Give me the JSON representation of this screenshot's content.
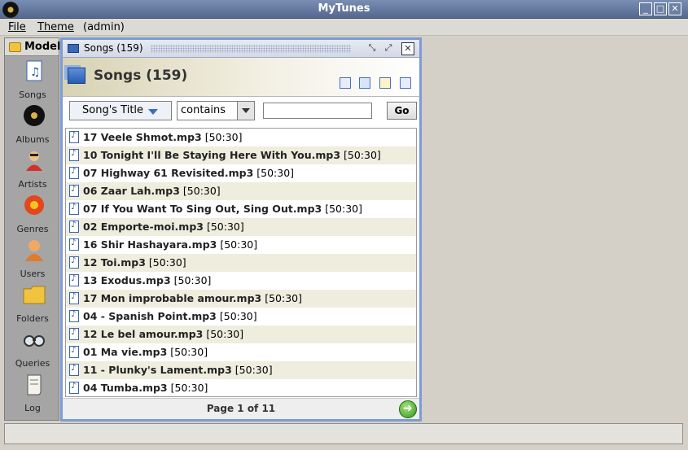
{
  "window": {
    "title": "MyTunes"
  },
  "menu": {
    "file": "File",
    "theme": "Theme",
    "user": "(admin)"
  },
  "sidebar": {
    "header": "Model",
    "items": [
      {
        "label": "Songs",
        "icon": "music-file-icon"
      },
      {
        "label": "Albums",
        "icon": "vinyl-record-icon"
      },
      {
        "label": "Artists",
        "icon": "artist-icon"
      },
      {
        "label": "Genres",
        "icon": "flower-icon"
      },
      {
        "label": "Users",
        "icon": "user-icon"
      },
      {
        "label": "Folders",
        "icon": "folder-icon"
      },
      {
        "label": "Queries",
        "icon": "binoculars-icon"
      },
      {
        "label": "Log",
        "icon": "scroll-icon"
      }
    ]
  },
  "frame": {
    "title": "Songs (159)",
    "header": "Songs (159)",
    "filter": {
      "field": "Song's Title",
      "condition": "contains",
      "query": "",
      "go": "Go"
    },
    "songs": [
      {
        "name": "17 Veele Shmot.mp3",
        "duration": "[50:30]"
      },
      {
        "name": "10 Tonight I'll Be Staying Here With You.mp3",
        "duration": "[50:30]"
      },
      {
        "name": "07 Highway 61 Revisited.mp3",
        "duration": "[50:30]"
      },
      {
        "name": "06 Zaar Lah.mp3",
        "duration": "[50:30]"
      },
      {
        "name": "07 If You Want To Sing Out, Sing Out.mp3",
        "duration": "[50:30]"
      },
      {
        "name": "02 Emporte-moi.mp3",
        "duration": "[50:30]"
      },
      {
        "name": "16 Shir Hashayara.mp3",
        "duration": "[50:30]"
      },
      {
        "name": "12 Toi.mp3",
        "duration": "[50:30]"
      },
      {
        "name": "13 Exodus.mp3",
        "duration": "[50:30]"
      },
      {
        "name": "17 Mon improbable amour.mp3",
        "duration": "[50:30]"
      },
      {
        "name": "04 - Spanish Point.mp3",
        "duration": "[50:30]"
      },
      {
        "name": "12 Le bel amour.mp3",
        "duration": "[50:30]"
      },
      {
        "name": "01 Ma vie.mp3",
        "duration": "[50:30]"
      },
      {
        "name": "11 - Plunky's Lament.mp3",
        "duration": "[50:30]"
      },
      {
        "name": "04 Tumba.mp3",
        "duration": "[50:30]"
      }
    ],
    "pager": {
      "text": "Page 1 of 11"
    }
  }
}
